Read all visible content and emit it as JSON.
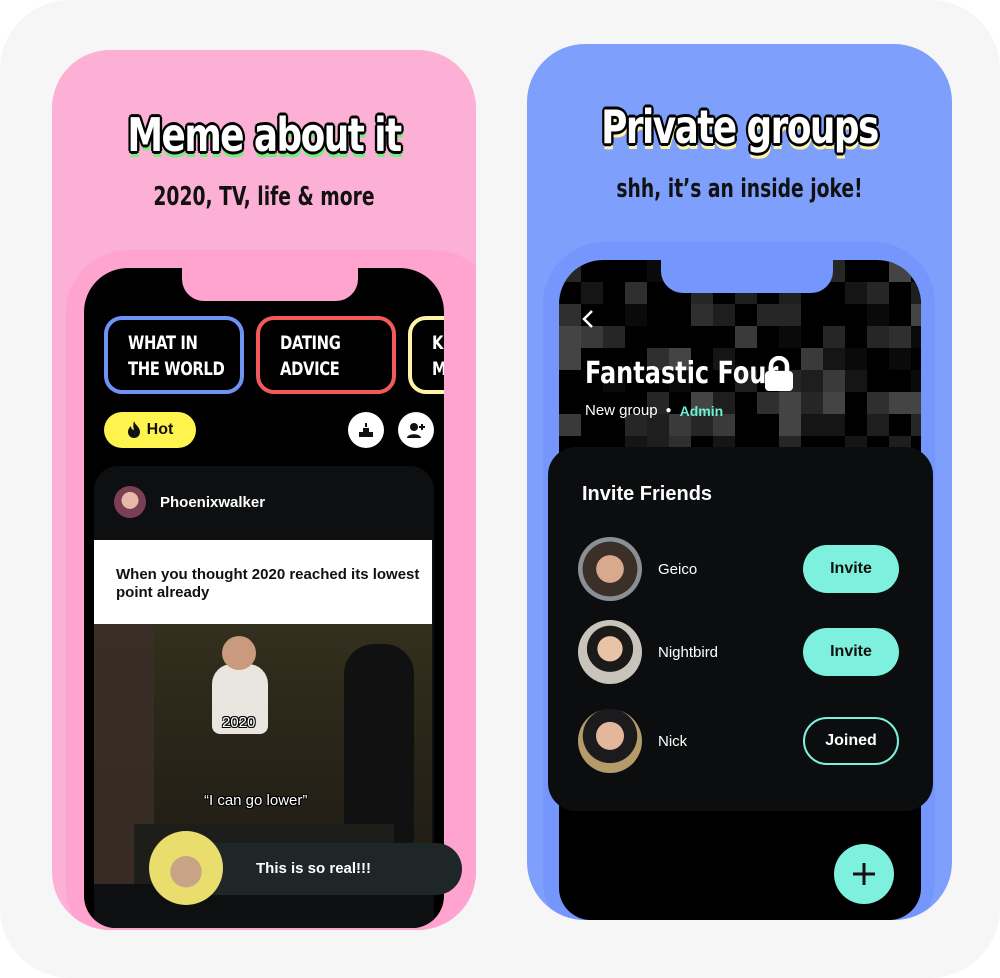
{
  "left_panel": {
    "headline": "Meme about it",
    "subline": "2020, TV,  life & more",
    "colors": {
      "background": "#fdb0d6",
      "headline_shadow": "#71f07e"
    },
    "categories": [
      {
        "label_line1": "What in",
        "label_line2": "the world",
        "border_color": "#6f93f5"
      },
      {
        "label_line1": "Dating",
        "label_line2": "advice",
        "border_color": "#f05a5a"
      },
      {
        "label_line1": "Kdrama",
        "label_line2": "memes",
        "border_color": "#fff3a6"
      }
    ],
    "filter": {
      "label": "Hot",
      "icon": "flame-icon",
      "color": "#fff34d"
    },
    "actions": [
      {
        "icon": "leaderboard-icon"
      },
      {
        "icon": "add-person-icon"
      }
    ],
    "post": {
      "username": "Phoenixwalker",
      "caption": "When you thought 2020 reached its lowest point already",
      "meme_label_top": "2020",
      "meme_label_bottom": "“I can go lower”",
      "comment": "This is so real!!!"
    }
  },
  "right_panel": {
    "headline": "Private groups",
    "subline": "shh,  it’s an inside joke!",
    "colors": {
      "background": "#7f9ffd",
      "headline_shadow": "#fff3a6",
      "accent": "#7df1dd"
    },
    "group": {
      "name": "Fantastic Four",
      "status": "New group",
      "role": "Admin"
    },
    "invite_section": {
      "title": "Invite Friends",
      "friends": [
        {
          "name": "Geico",
          "action": "Invite",
          "state": "invite"
        },
        {
          "name": "Nightbird",
          "action": "Invite",
          "state": "invite"
        },
        {
          "name": "Nick",
          "action": "Joined",
          "state": "joined"
        }
      ]
    },
    "fab": {
      "icon": "plus-icon"
    }
  }
}
